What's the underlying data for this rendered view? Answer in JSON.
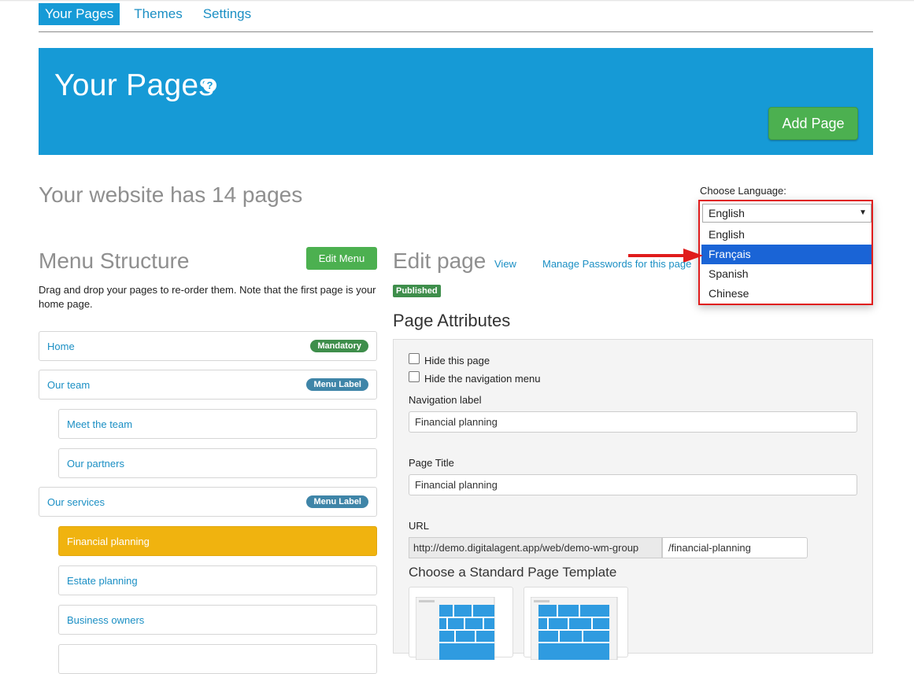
{
  "nav": {
    "tabs": [
      "Your Pages",
      "Themes",
      "Settings"
    ]
  },
  "hero": {
    "title": "Your Pages",
    "help_glyph": "?",
    "add_page": "Add Page"
  },
  "site_count": "Your website has 14 pages",
  "language": {
    "label": "Choose Language:",
    "selected": "English",
    "options": [
      "English",
      "Français",
      "Spanish",
      "Chinese"
    ],
    "highlighted": "Français"
  },
  "menu": {
    "title": "Menu Structure",
    "edit_button": "Edit Menu",
    "description": "Drag and drop your pages to re-order them. Note that the first page is your home page.",
    "items": [
      {
        "label": "Home",
        "badge": "Mandatory"
      },
      {
        "label": "Our team",
        "badge": "Menu Label"
      },
      {
        "label": "Meet the team"
      },
      {
        "label": "Our partners"
      },
      {
        "label": "Our services",
        "badge": "Menu Label"
      },
      {
        "label": "Financial planning",
        "active": true
      },
      {
        "label": "Estate planning"
      },
      {
        "label": "Business owners"
      }
    ]
  },
  "edit": {
    "title": "Edit page",
    "view_link": "View",
    "passwords_link": "Manage Passwords for this page",
    "status": "Published",
    "attributes_title": "Page Attributes",
    "hide_page": "Hide this page",
    "hide_nav": "Hide the navigation menu",
    "nav_label_title": "Navigation label",
    "nav_label_value": "Financial planning",
    "page_title_label": "Page Title",
    "page_title_value": "Financial planning",
    "url_label": "URL",
    "url_prefix": "http://demo.digitalagent.app/web/demo-wm-group",
    "url_slug": "/financial-planning",
    "template_title": "Choose a Standard Page Template"
  },
  "colors": {
    "primary": "#169ad6",
    "success": "#4cb050",
    "active_item": "#f0b30f",
    "annotation": "#e01c1c"
  }
}
